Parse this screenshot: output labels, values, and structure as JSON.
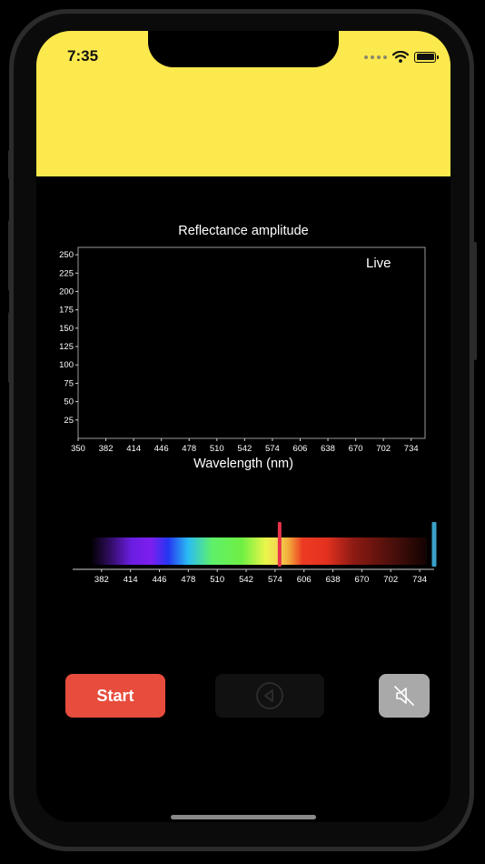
{
  "status_bar": {
    "time": "7:35",
    "icons": [
      "signal-dots-icon",
      "wifi-icon",
      "battery-icon"
    ]
  },
  "header": {
    "background": "#fce94d"
  },
  "chart_data": {
    "type": "line",
    "title": "Reflectance amplitude",
    "xlabel": "Wavelength (nm)",
    "ylabel": "",
    "xlim": [
      350,
      750
    ],
    "ylim": [
      0,
      260
    ],
    "x_ticks": [
      350,
      382,
      414,
      446,
      478,
      510,
      542,
      574,
      606,
      638,
      670,
      702,
      734
    ],
    "y_ticks": [
      25,
      50,
      75,
      100,
      125,
      150,
      175,
      200,
      225,
      250
    ],
    "series": [],
    "annotation": "Live",
    "grid": false
  },
  "spectrum": {
    "ticks": [
      382,
      414,
      446,
      478,
      510,
      542,
      574,
      606,
      638,
      670,
      702,
      734
    ],
    "marker_red": 579,
    "marker_blue": 750,
    "marker_red_color": "#e8334a",
    "marker_blue_color": "#3aa0c8"
  },
  "controls": {
    "start_label": "Start",
    "start_color": "#e74c3c",
    "play_icon": "play-back-icon",
    "mute_icon": "speaker-mute-icon"
  }
}
